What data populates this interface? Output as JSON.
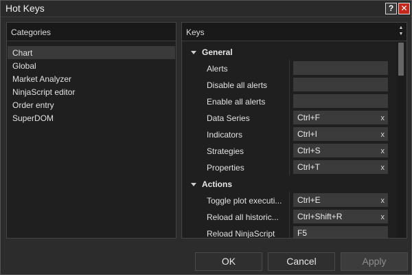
{
  "window": {
    "title": "Hot Keys",
    "help_label": "?",
    "close_label": "✕"
  },
  "categories": {
    "header": "Categories",
    "selected": "Chart",
    "items": [
      "Chart",
      "Global",
      "Market Analyzer",
      "NinjaScript editor",
      "Order entry",
      "SuperDOM"
    ]
  },
  "keys": {
    "header": "Keys",
    "clear_label": "x",
    "groups": [
      {
        "name": "General",
        "rows": [
          {
            "name": "Alerts",
            "key": ""
          },
          {
            "name": "Disable all alerts",
            "key": ""
          },
          {
            "name": "Enable all alerts",
            "key": ""
          },
          {
            "name": "Data Series",
            "key": "Ctrl+F"
          },
          {
            "name": "Indicators",
            "key": "Ctrl+I"
          },
          {
            "name": "Strategies",
            "key": "Ctrl+S"
          },
          {
            "name": "Properties",
            "key": "Ctrl+T"
          }
        ]
      },
      {
        "name": "Actions",
        "rows": [
          {
            "name": "Toggle plot executi...",
            "key": "Ctrl+E"
          },
          {
            "name": "Reload all historic...",
            "key": "Ctrl+Shift+R"
          },
          {
            "name": "Reload NinjaScript",
            "key": "F5"
          }
        ]
      }
    ]
  },
  "buttons": {
    "ok": "OK",
    "cancel": "Cancel",
    "apply": "Apply"
  },
  "colors": {
    "close_button": "#c4281c",
    "panel_bg": "#1f1f1f",
    "key_field_bg": "#3b3b3b"
  }
}
